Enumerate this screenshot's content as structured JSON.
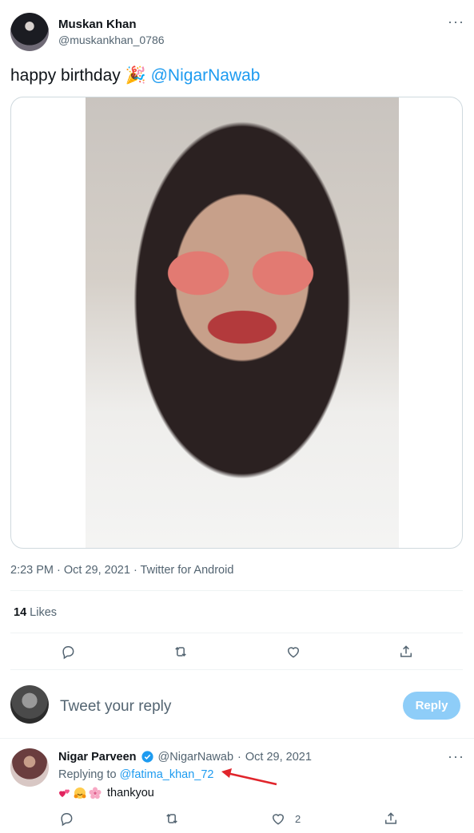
{
  "tweet": {
    "author_name": "Muskan Khan",
    "author_handle": "@muskankhan_0786",
    "more": "···",
    "text_pre": "happy birthday",
    "text_emoji": "🎉",
    "text_mention": "@NigarNawab",
    "meta": "2:23 PM · Oct 29, 2021 · Twitter for Android",
    "likes_count": "14",
    "likes_label": "Likes"
  },
  "composer": {
    "placeholder": "Tweet your reply",
    "reply_button": "Reply"
  },
  "reply": {
    "author_name": "Nigar Parveen",
    "author_handle": "@NigarNawab",
    "separator": "·",
    "date": "Oct 29, 2021",
    "more": "···",
    "replying_prefix": "Replying to",
    "replying_mention": "@fatima_khan_72",
    "text": "thankyou",
    "reply_count": "2"
  },
  "colors": {
    "accent": "#1d9bf0",
    "secondary_text": "#536471",
    "reply_button_disabled": "#8ecdf8",
    "annotation_arrow": "#e0242b"
  },
  "icons": [
    "reply-icon",
    "retweet-icon",
    "like-icon",
    "share-icon",
    "more-icon",
    "verified-badge-icon"
  ]
}
